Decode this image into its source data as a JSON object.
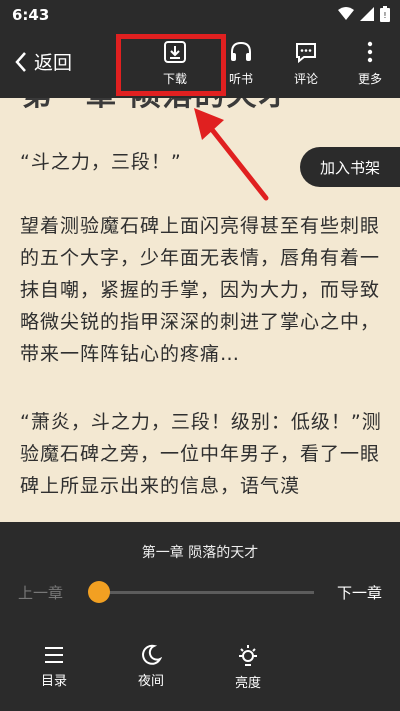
{
  "status_bar": {
    "time": "6:43"
  },
  "toolbar": {
    "back_label": "返回",
    "download_label": "下载",
    "listen_label": "听书",
    "comment_label": "评论",
    "more_label": "更多"
  },
  "content": {
    "chapter_heading": "第一章 陨落的天才",
    "paragraphs": [
      "“斗之力，三段！”",
      "望着测验魔石碑上面闪亮得甚至有些刺眼的五个大字，少年面无表情，唇角有着一抹自嘲，紧握的手掌，因为大力，而导致略微尖锐的指甲深深的刺进了掌心之中，带来一阵阵钻心的疼痛…",
      "“萧炎，斗之力，三段！级别：低级！”测验魔石碑之旁，一位中年男子，看了一眼碑上所显示出来的信息，语气漠"
    ],
    "add_bookshelf_label": "加入书架"
  },
  "bottom_panel": {
    "chapter_title": "第一章 陨落的天才",
    "prev_chapter_label": "上一章",
    "next_chapter_label": "下一章",
    "progress": 0.0,
    "toc_label": "目录",
    "night_label": "夜间",
    "brightness_label": "亮度"
  },
  "colors": {
    "panel_bg": "#2b2b2b",
    "page_bg": "#f3e8d2",
    "accent_orange": "#f2a022",
    "highlight_red": "#e02020"
  }
}
